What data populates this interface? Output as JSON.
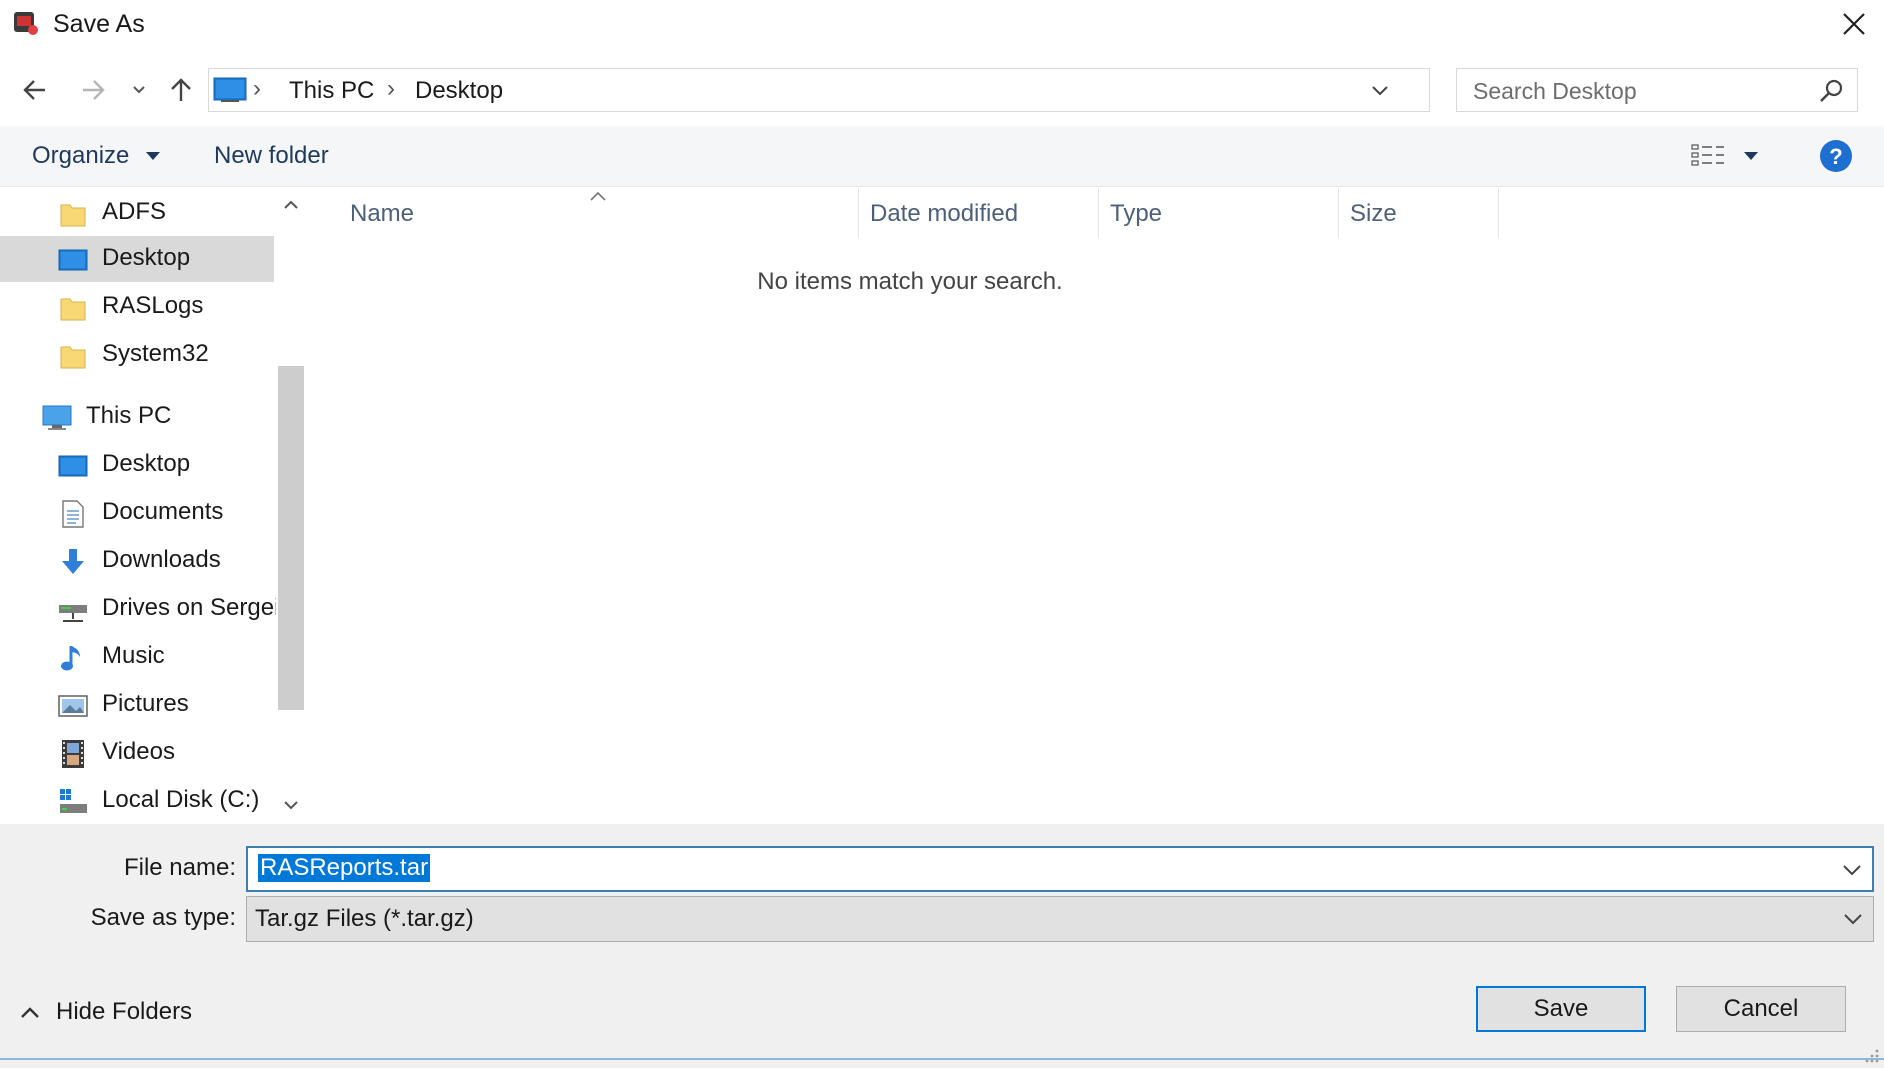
{
  "window": {
    "title": "Save As"
  },
  "address": {
    "crumbs": [
      "This PC",
      "Desktop"
    ]
  },
  "search": {
    "placeholder": "Search Desktop"
  },
  "toolbar": {
    "organize_label": "Organize",
    "new_folder_label": "New folder"
  },
  "navpane": {
    "items": [
      {
        "label": "ADFS",
        "icon": "folder-icon"
      },
      {
        "label": "Desktop",
        "icon": "desktop-icon",
        "selected": true
      },
      {
        "label": "RASLogs",
        "icon": "folder-icon"
      },
      {
        "label": "System32",
        "icon": "folder-icon"
      },
      {
        "label": "This PC",
        "icon": "this-pc-icon"
      },
      {
        "label": "Desktop",
        "icon": "desktop-icon"
      },
      {
        "label": "Documents",
        "icon": "documents-icon"
      },
      {
        "label": "Downloads",
        "icon": "downloads-icon"
      },
      {
        "label": "Drives on Sergei'",
        "icon": "network-drive-icon"
      },
      {
        "label": "Music",
        "icon": "music-icon"
      },
      {
        "label": "Pictures",
        "icon": "pictures-icon"
      },
      {
        "label": "Videos",
        "icon": "videos-icon"
      },
      {
        "label": "Local Disk (C:)",
        "icon": "local-disk-icon"
      }
    ]
  },
  "content": {
    "columns": [
      "Name",
      "Date modified",
      "Type",
      "Size"
    ],
    "empty_message": "No items match your search."
  },
  "form": {
    "file_name_label": "File name:",
    "file_name_value": "RASReports.tar",
    "save_type_label": "Save as type:",
    "save_type_value": "Tar.gz Files (*.tar.gz)"
  },
  "footer": {
    "hide_folders_label": "Hide Folders",
    "save_label": "Save",
    "cancel_label": "Cancel"
  },
  "colors": {
    "accent": "#0078d7",
    "selection": "#d9d9d9",
    "link_text": "#1e395b"
  }
}
